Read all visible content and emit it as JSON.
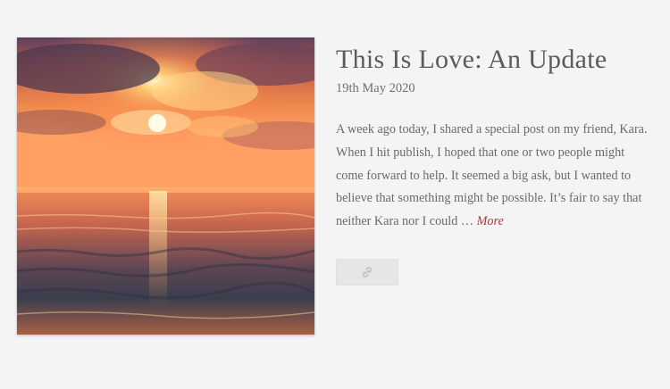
{
  "post": {
    "image_icon": "sunset-over-sea-image",
    "title": "This Is Love: An Update",
    "date": "19th May 2020",
    "excerpt_lines": [
      "A week ago today, I shared a special post on my friend, Kara.",
      "When I hit publish, I hoped that one or two people might",
      "come forward to help.  It seemed a big ask, but I wanted to",
      "believe that something might be possible.   It’s fair to say that",
      "neither Kara nor I could … "
    ],
    "more_label": "More",
    "link_button_icon": "link-icon"
  },
  "colors": {
    "background": "#f4f4f4",
    "title": "#5b5b5b",
    "text": "#6a6a6a",
    "more_link": "#b5383b",
    "button": "#e6e6e6"
  }
}
